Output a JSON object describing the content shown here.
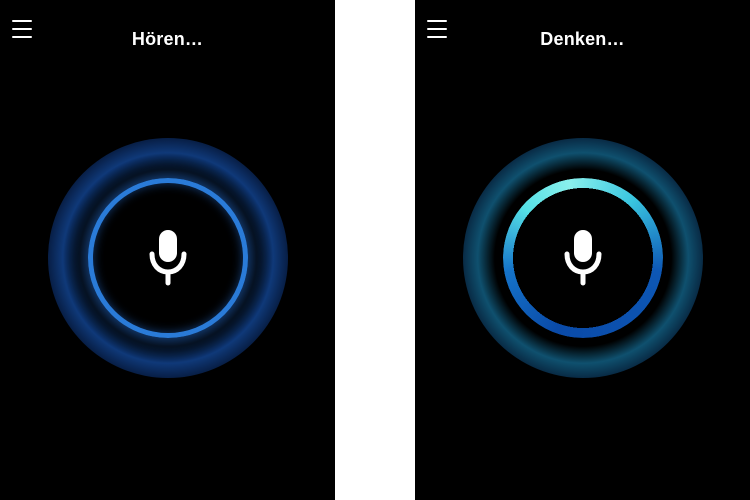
{
  "screens": [
    {
      "state": "listening",
      "title": "Hören…",
      "menu_icon": "menu-icon",
      "mic_icon": "microphone-icon",
      "ring_color_primary": "#2a7bd8",
      "glow_color": "#1c68dc"
    },
    {
      "state": "thinking",
      "title": "Denken…",
      "menu_icon": "menu-icon",
      "mic_icon": "microphone-icon",
      "ring_color_primary": "#55e0e6",
      "ring_color_secondary": "#0a4aa8",
      "glow_color": "#1ea0dc"
    }
  ]
}
